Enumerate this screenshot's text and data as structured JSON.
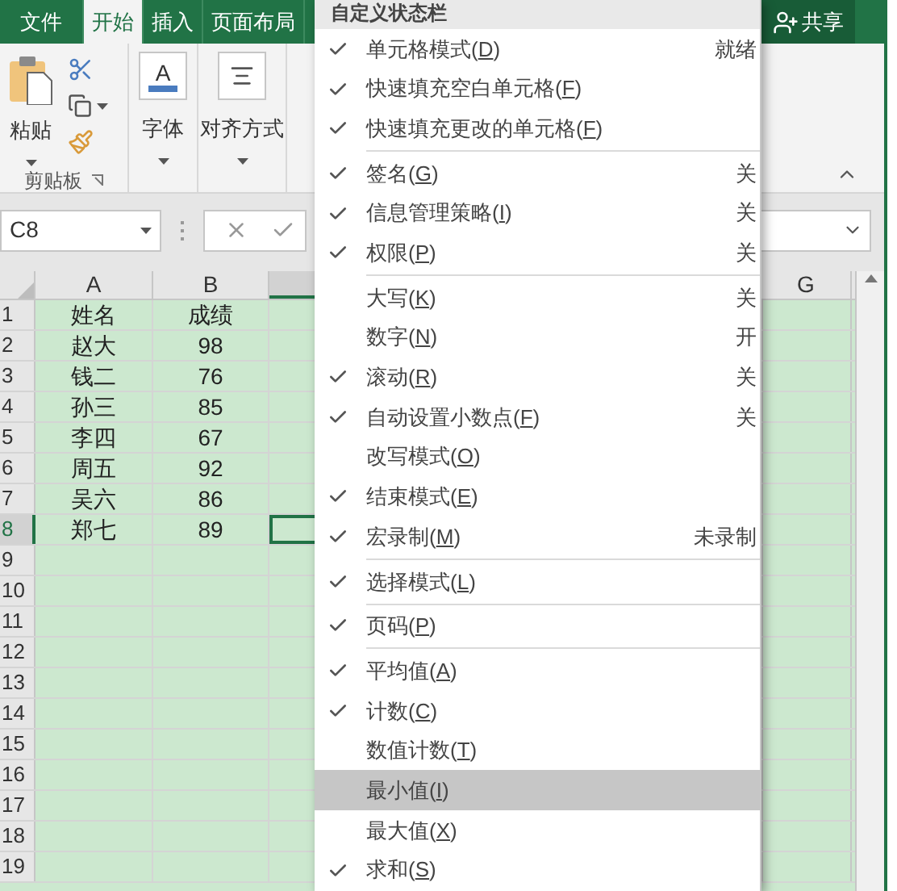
{
  "tabs": [
    {
      "label": "文件",
      "selected": false
    },
    {
      "label": "开始",
      "selected": true
    },
    {
      "label": "插入",
      "selected": false
    },
    {
      "label": "页面布局",
      "selected": false
    }
  ],
  "share_button": "共享",
  "ribbon": {
    "paste": "粘贴",
    "clipboard_group": "剪贴板",
    "font_glyph": "A",
    "font": "字体",
    "alignment": "对齐方式"
  },
  "name_box": "C8",
  "columns": [
    "A",
    "B",
    "G"
  ],
  "rows": [
    {
      "number": "1",
      "cells": [
        "姓名",
        "成绩"
      ],
      "selected": false
    },
    {
      "number": "2",
      "cells": [
        "赵大",
        "98"
      ],
      "selected": false
    },
    {
      "number": "3",
      "cells": [
        "钱二",
        "76"
      ],
      "selected": false
    },
    {
      "number": "4",
      "cells": [
        "孙三",
        "85"
      ],
      "selected": false
    },
    {
      "number": "5",
      "cells": [
        "李四",
        "67"
      ],
      "selected": false
    },
    {
      "number": "6",
      "cells": [
        "周五",
        "92"
      ],
      "selected": false
    },
    {
      "number": "7",
      "cells": [
        "吴六",
        "86"
      ],
      "selected": false
    },
    {
      "number": "8",
      "cells": [
        "郑七",
        "89"
      ],
      "selected": true
    },
    {
      "number": "9",
      "selected": false
    },
    {
      "number": "10",
      "selected": false
    },
    {
      "number": "11",
      "selected": false
    },
    {
      "number": "12",
      "selected": false
    },
    {
      "number": "13",
      "selected": false
    },
    {
      "number": "14",
      "selected": false
    },
    {
      "number": "15",
      "selected": false
    },
    {
      "number": "16",
      "selected": false
    },
    {
      "number": "17",
      "selected": false
    },
    {
      "number": "18",
      "selected": false
    },
    {
      "number": "19",
      "selected": false
    }
  ],
  "menu": {
    "title": "自定义状态栏",
    "items": [
      {
        "kind": "item",
        "label": "单元格模式(D)",
        "checked": true,
        "value": "就绪",
        "highlighted": false
      },
      {
        "kind": "item",
        "label": "快速填充空白单元格(F)",
        "checked": true,
        "highlighted": false
      },
      {
        "kind": "item",
        "label": "快速填充更改的单元格(F)",
        "checked": true,
        "highlighted": false
      },
      {
        "kind": "separator"
      },
      {
        "kind": "item",
        "label": "签名(G)",
        "checked": true,
        "value": "关",
        "highlighted": false
      },
      {
        "kind": "item",
        "label": "信息管理策略(I)",
        "checked": true,
        "value": "关",
        "highlighted": false
      },
      {
        "kind": "item",
        "label": "权限(P)",
        "checked": true,
        "value": "关",
        "highlighted": false
      },
      {
        "kind": "separator"
      },
      {
        "kind": "item",
        "label": "大写(K)",
        "checked": false,
        "value": "关",
        "highlighted": false
      },
      {
        "kind": "item",
        "label": "数字(N)",
        "checked": false,
        "value": "开",
        "highlighted": false
      },
      {
        "kind": "item",
        "label": "滚动(R)",
        "checked": true,
        "value": "关",
        "highlighted": false
      },
      {
        "kind": "item",
        "label": "自动设置小数点(F)",
        "checked": true,
        "value": "关",
        "highlighted": false
      },
      {
        "kind": "item",
        "label": "改写模式(O)",
        "checked": false,
        "highlighted": false
      },
      {
        "kind": "item",
        "label": "结束模式(E)",
        "checked": true,
        "highlighted": false
      },
      {
        "kind": "item",
        "label": "宏录制(M)",
        "checked": true,
        "value": "未录制",
        "highlighted": false
      },
      {
        "kind": "separator"
      },
      {
        "kind": "item",
        "label": "选择模式(L)",
        "checked": true,
        "highlighted": false
      },
      {
        "kind": "separator"
      },
      {
        "kind": "item",
        "label": "页码(P)",
        "checked": true,
        "highlighted": false
      },
      {
        "kind": "separator"
      },
      {
        "kind": "item",
        "label": "平均值(A)",
        "checked": true,
        "highlighted": false
      },
      {
        "kind": "item",
        "label": "计数(C)",
        "checked": true,
        "highlighted": false
      },
      {
        "kind": "item",
        "label": "数值计数(T)",
        "checked": false,
        "highlighted": false
      },
      {
        "kind": "item",
        "label": "最小值(I)",
        "checked": false,
        "highlighted": true
      },
      {
        "kind": "item",
        "label": "最大值(X)",
        "checked": false,
        "highlighted": false
      },
      {
        "kind": "item",
        "label": "求和(S)",
        "checked": true,
        "highlighted": false
      }
    ]
  }
}
